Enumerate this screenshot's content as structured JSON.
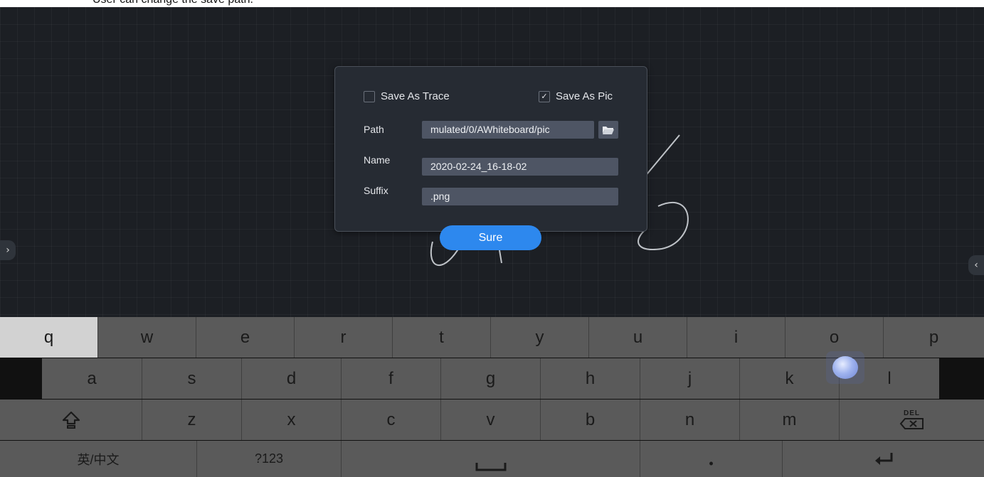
{
  "caption": "User can change the save path.",
  "dialog": {
    "save_as_trace_label": "Save As Trace",
    "save_as_trace_checked": false,
    "save_as_pic_label": "Save As Pic",
    "save_as_pic_checked": true,
    "check_mark": "✓",
    "path_label": "Path",
    "path_value": "mulated/0/AWhiteboard/pic",
    "name_label": "Name",
    "name_value": "2020-02-24_16-18-02",
    "suffix_label": "Suffix",
    "suffix_value": ".png",
    "sure_label": "Sure",
    "folder_icon": "folder-open-icon"
  },
  "edges": {
    "left_arrow": "›",
    "right_arrow": "‹"
  },
  "keyboard": {
    "row1": [
      "q",
      "w",
      "e",
      "r",
      "t",
      "y",
      "u",
      "i",
      "o",
      "p"
    ],
    "row2": [
      "a",
      "s",
      "d",
      "f",
      "g",
      "h",
      "j",
      "k",
      "l"
    ],
    "row3": [
      "z",
      "x",
      "c",
      "v",
      "b",
      "n",
      "m"
    ],
    "shift_icon": "shift-icon",
    "del_label": "DEL",
    "lang_label": "英/中文",
    "num_label": "?123",
    "period_label": "•",
    "space_icon": "space-icon",
    "enter_icon": "enter-icon"
  }
}
